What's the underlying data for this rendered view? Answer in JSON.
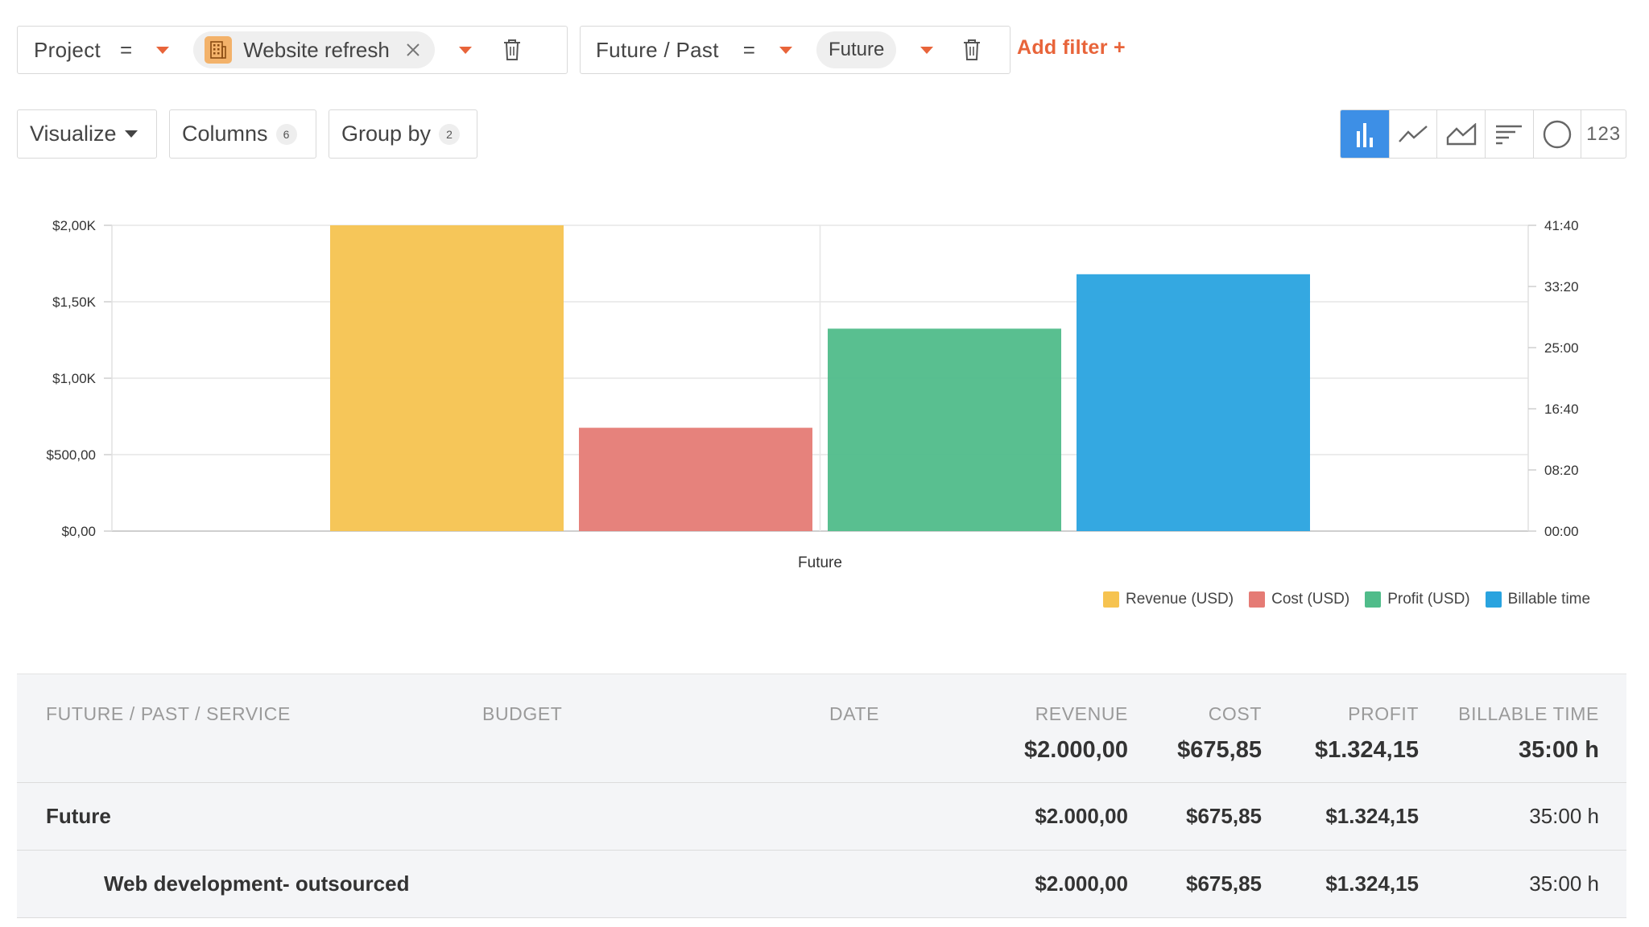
{
  "filters": [
    {
      "field": "Project",
      "operator": "=",
      "value": "Website refresh",
      "value_icon": "building-icon"
    },
    {
      "field": "Future / Past",
      "operator": "=",
      "value": "Future"
    }
  ],
  "add_filter_label": "Add filter +",
  "toolbar": {
    "visualize_label": "Visualize",
    "columns_label": "Columns",
    "columns_count": "6",
    "group_by_label": "Group by",
    "group_by_count": "2",
    "chart_types": [
      "bar-chart-icon",
      "line-chart-icon",
      "area-chart-icon",
      "horizontal-bar-icon",
      "pie-chart-icon",
      "number-icon"
    ],
    "number_label": "123",
    "active_chart_type": "bar-chart-icon"
  },
  "chart_data": {
    "type": "bar",
    "categories": [
      "Future"
    ],
    "series": [
      {
        "name": "Revenue (USD)",
        "values": [
          2000.0
        ],
        "axis": "left",
        "color": "#f6c350"
      },
      {
        "name": "Cost (USD)",
        "values": [
          675.85
        ],
        "axis": "left",
        "color": "#e57b75"
      },
      {
        "name": "Profit (USD)",
        "values": [
          1324.15
        ],
        "axis": "left",
        "color": "#50bc8a"
      },
      {
        "name": "Billable time",
        "values": [
          35.0
        ],
        "axis": "right",
        "unit": "hours",
        "color": "#29a3df"
      }
    ],
    "y_left": {
      "ticks": [
        "$0,00",
        "$500,00",
        "$1,00K",
        "$1,50K",
        "$2,00K"
      ],
      "lim": [
        0,
        2000
      ]
    },
    "y_right": {
      "ticks": [
        "00:00",
        "08:20",
        "16:40",
        "25:00",
        "33:20",
        "41:40"
      ],
      "lim": [
        0,
        41.6667
      ],
      "unit": "hours"
    },
    "grid": true,
    "legend_position": "bottom-right"
  },
  "table": {
    "headers": [
      "FUTURE / PAST / SERVICE",
      "BUDGET",
      "DATE",
      "REVENUE",
      "COST",
      "PROFIT",
      "BILLABLE TIME"
    ],
    "totals": {
      "revenue": "$2.000,00",
      "cost": "$675,85",
      "profit": "$1.324,15",
      "billable_time": "35:00 h"
    },
    "rows": [
      {
        "name": "Future",
        "revenue": "$2.000,00",
        "cost": "$675,85",
        "profit": "$1.324,15",
        "billable_time": "35:00 h"
      },
      {
        "name": "Web development- outsourced",
        "revenue": "$2.000,00",
        "cost": "$675,85",
        "profit": "$1.324,15",
        "billable_time": "35:00 h"
      }
    ]
  },
  "colors": {
    "accent": "#e8643a",
    "active_blue": "#3d8fe6"
  }
}
